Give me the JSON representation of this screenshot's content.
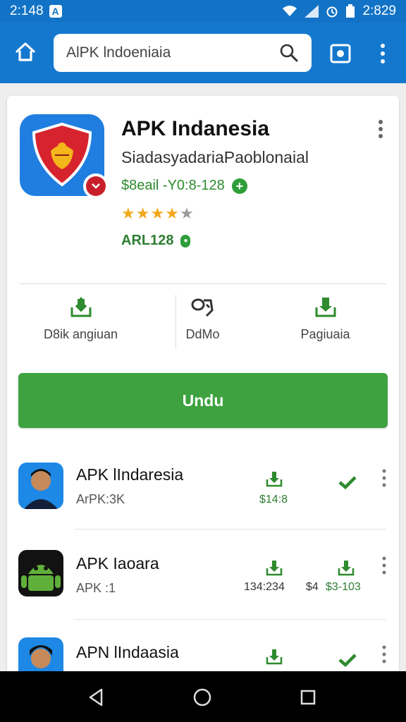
{
  "status_bar": {
    "time": "2:148",
    "right_time": "2:829",
    "icons": [
      "notification-icon",
      "wifi-icon",
      "signal-icon",
      "alarm-icon",
      "battery-icon"
    ]
  },
  "toolbar": {
    "search_value": "AlPK lndoeniaia",
    "icons": [
      "home-icon",
      "search-icon",
      "screenshot-icon",
      "more-vert-icon"
    ]
  },
  "app": {
    "title": "APK Indanesia",
    "subtitle": "SiadasyadariaPaoblonaial",
    "price": "$8eail -Y0:8-128",
    "rating": 4,
    "rating_max": 5,
    "code": "ARL128"
  },
  "actions": [
    {
      "label": "D8ik angiuan",
      "icon": "download-icon"
    },
    {
      "label": "DdMo",
      "icon": "share-icon"
    },
    {
      "label": "Pagiuaia",
      "icon": "download-icon"
    }
  ],
  "download_button": {
    "label": "Undu"
  },
  "list": [
    {
      "title": "APK lIndaresia",
      "sub": "ArPK:3K",
      "size": "$14:8",
      "action": "check"
    },
    {
      "title": "APK Iaoara",
      "sub": "APK :1",
      "size": "134:234",
      "size2": "$4",
      "size3": "$3-103",
      "action": "download"
    },
    {
      "title": "APN lIndaasia",
      "sub": "",
      "size": "",
      "action": "check"
    }
  ],
  "colors": {
    "primary": "#1478cf",
    "status": "#1273c6",
    "green": "#3da23f",
    "star": "#f2a81b"
  }
}
